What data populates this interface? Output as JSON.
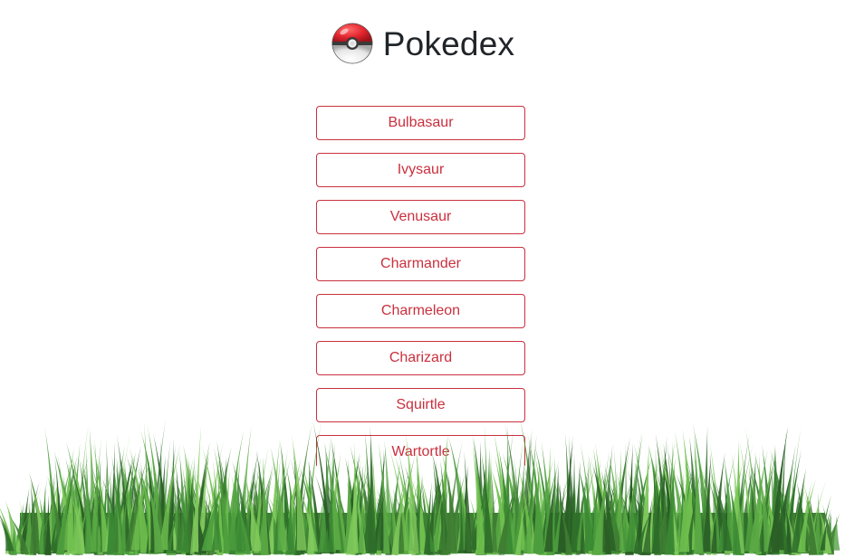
{
  "header": {
    "title": "Pokedex",
    "logo_icon": "pokeball-icon"
  },
  "pokemon_list": [
    {
      "name": "Bulbasaur"
    },
    {
      "name": "Ivysaur"
    },
    {
      "name": "Venusaur"
    },
    {
      "name": "Charmander"
    },
    {
      "name": "Charmeleon"
    },
    {
      "name": "Charizard"
    },
    {
      "name": "Squirtle"
    },
    {
      "name": "Wartortle"
    }
  ],
  "colors": {
    "accent": "#c9303e",
    "title": "#212529",
    "grass_dark": "#2e6e2a",
    "grass_light": "#6fbf4e"
  },
  "decoration": {
    "footer_image": "grass-image"
  }
}
